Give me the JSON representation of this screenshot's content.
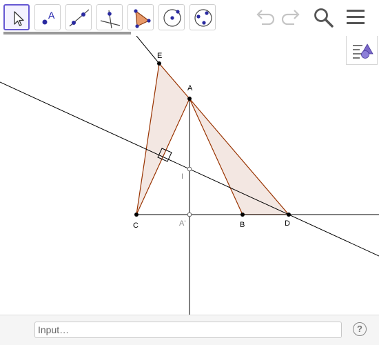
{
  "toolbar": {
    "tools": [
      {
        "name": "move-tool",
        "selected": true
      },
      {
        "name": "point-tool",
        "glyph": "A"
      },
      {
        "name": "line-tool"
      },
      {
        "name": "perpendicular-line-tool"
      },
      {
        "name": "polygon-tool"
      },
      {
        "name": "circle-with-center-tool"
      },
      {
        "name": "circle-through-three-points-tool"
      }
    ],
    "actions": [
      "undo-icon",
      "redo-icon",
      "search-icon",
      "menu-icon"
    ]
  },
  "graphics": {
    "points": {
      "E": "E",
      "A": "A",
      "I": "I",
      "C": "C",
      "A_prime": "A'",
      "B": "B",
      "D": "D"
    },
    "colors": {
      "polygon_edge": "#993300",
      "polygon_fill": "#f3e7e2",
      "line": "#000000",
      "helper_label": "#888888",
      "point": "#000000"
    }
  },
  "input_bar": {
    "placeholder": "Input…",
    "help": "?"
  }
}
